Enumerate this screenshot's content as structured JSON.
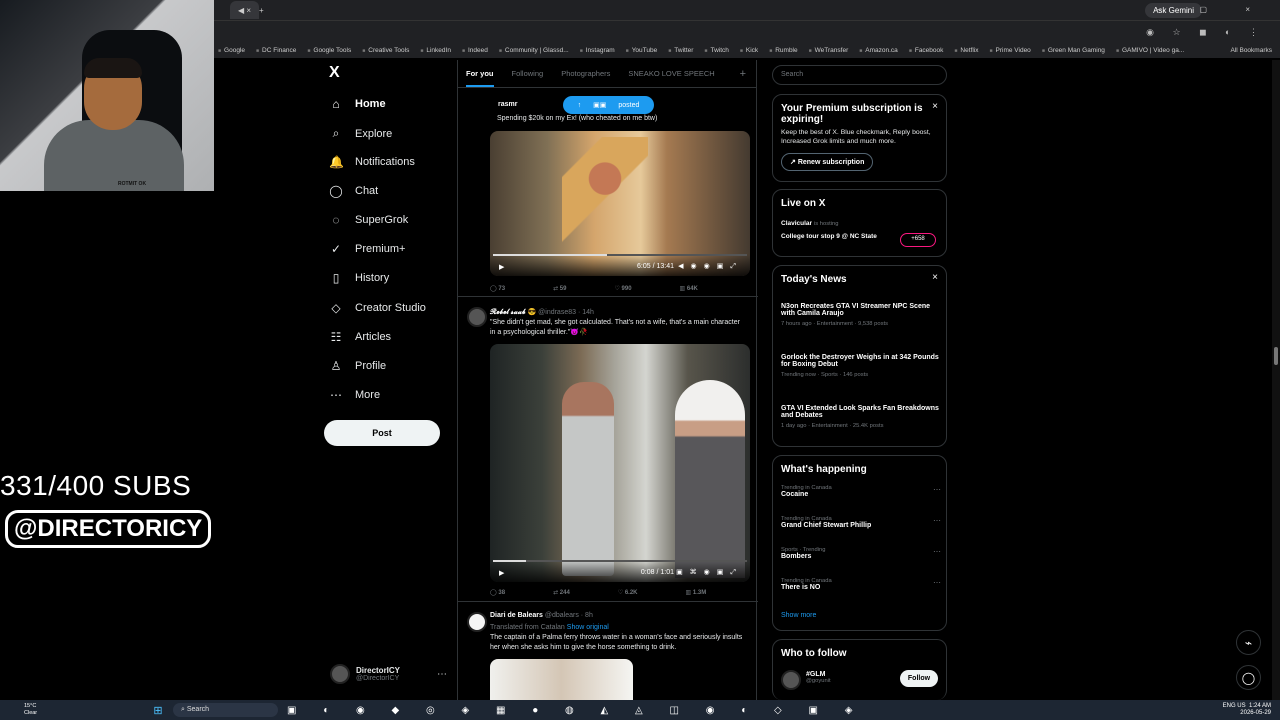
{
  "browser": {
    "tab_icons": "◀ ×",
    "new_tab": "+",
    "ask_gemini": "Ask Gemini",
    "window_controls": "− ▢ ×",
    "toolbar_icons": "◉ ☆ ◼ ◐ ⋮"
  },
  "bookmarks": [
    "Google",
    "DC Finance",
    "Google Tools",
    "Creative Tools",
    "LinkedIn",
    "Indeed",
    "Community | Glassd...",
    "Instagram",
    "YouTube",
    "Twitter",
    "Twitch",
    "Kick",
    "Rumble",
    "WeTransfer",
    "Amazon.ca",
    "Facebook",
    "Netflix",
    "Prime Video",
    "Green Man Gaming",
    "GAMIVO | Video ga..."
  ],
  "all_bookmarks": "All Bookmarks",
  "overlay": {
    "webcam_text": "ROTMIT OK",
    "subs": "331/400 SUBS",
    "handle": "@DIRECTORICY"
  },
  "x_nav": {
    "logo": "X",
    "items": [
      {
        "label": "Home",
        "icon": "⌂",
        "active": true
      },
      {
        "label": "Explore",
        "icon": "⌕"
      },
      {
        "label": "Notifications",
        "icon": "🔔"
      },
      {
        "label": "Chat",
        "icon": "◯"
      },
      {
        "label": "SuperGrok",
        "icon": "◌"
      },
      {
        "label": "Premium+",
        "icon": "✓"
      },
      {
        "label": "History",
        "icon": "▯"
      },
      {
        "label": "Creator Studio",
        "icon": "◇"
      },
      {
        "label": "Articles",
        "icon": "☷"
      },
      {
        "label": "Profile",
        "icon": "♙"
      },
      {
        "label": "More",
        "icon": "⋯"
      }
    ],
    "post": "Post",
    "profile_name": "DirectorICY",
    "profile_handle": "@DirectorICY",
    "more_icon": "⋯"
  },
  "feed": {
    "tabs": [
      "For you",
      "Following",
      "Photographers",
      "SNEAKO LOVE SPEECH"
    ],
    "tab_add": "+",
    "posted_pill": "posted",
    "post1": {
      "author": "rasmr",
      "text": "Spending $20k on my Ex! (who cheated on me btw)",
      "time": "6:05 / 13:41",
      "progress": 0.45,
      "reply": "73",
      "repost": "59",
      "like": "990",
      "views": "64K"
    },
    "post2": {
      "author": "𝓡𝓮𝓫𝓮𝓵 𝓼𝓪𝓪𝓫 😎",
      "handle": "@indrase83 · 14h",
      "text": "\"She didn't get mad, she got calculated. That's not a wife, that's a main character in a psychological thriller.\"😈🥀",
      "time": "0:08 / 1:01",
      "progress": 0.13,
      "reply": "38",
      "repost": "244",
      "like": "6.2K",
      "views": "1.3M"
    },
    "post3": {
      "author": "Diari de Balears",
      "handle": "@dbalears · 8h",
      "translated": "Translated from Catalan",
      "show_original": "Show original",
      "text": "The captain of a Palma ferry throws water in a woman's face and seriously insults her when she asks him to give the horse something to drink."
    }
  },
  "sidebar": {
    "search": "Search",
    "premium": {
      "title": "Your Premium subscription is expiring!",
      "text": "Keep the best of X. Blue checkmark, Reply boost, Increased Grok limits and much more.",
      "button": "Renew subscription",
      "close": "×"
    },
    "live": {
      "title": "Live on X",
      "host": "Clavicular",
      "hosting": "is hosting",
      "event": "College tour stop 9 @ NC State",
      "listeners": "+658"
    },
    "news": {
      "title": "Today's News",
      "close": "×",
      "items": [
        {
          "title": "N3on Recreates GTA VI Streamer NPC Scene with Camila Araujo",
          "meta": "7 hours ago · Entertainment · 9,538 posts"
        },
        {
          "title": "Gorlock the Destroyer Weighs in at 342 Pounds for Boxing Debut",
          "meta": "Trending now · Sports · 146 posts"
        },
        {
          "title": "GTA VI Extended Look Sparks Fan Breakdowns and Debates",
          "meta": "1 day ago · Entertainment · 25.4K posts"
        }
      ]
    },
    "happening": {
      "title": "What's happening",
      "items": [
        {
          "context": "Trending in Canada",
          "title": "Cocaine"
        },
        {
          "context": "Trending in Canada",
          "title": "Grand Chief Stewart Phillip"
        },
        {
          "context": "Sports · Trending",
          "title": "Bombers"
        },
        {
          "context": "Trending in Canada",
          "title": "There is NO"
        }
      ],
      "show_more": "Show more"
    },
    "follow": {
      "title": "Who to follow",
      "name": "#GLM",
      "handle": "@goyunit",
      "button": "Follow"
    }
  },
  "taskbar": {
    "temp": "15°C",
    "condition": "Clear",
    "search": "Search",
    "icons": "▣ ◐ ◉ ◆ ◎ ◈ ▦ ● ◍ ◭ ◬ ◫ ◉ ◐ ◇ ▣ ◈",
    "language": "ENG\nUS",
    "time": "1:24 AM",
    "date": "2026-05-29"
  }
}
